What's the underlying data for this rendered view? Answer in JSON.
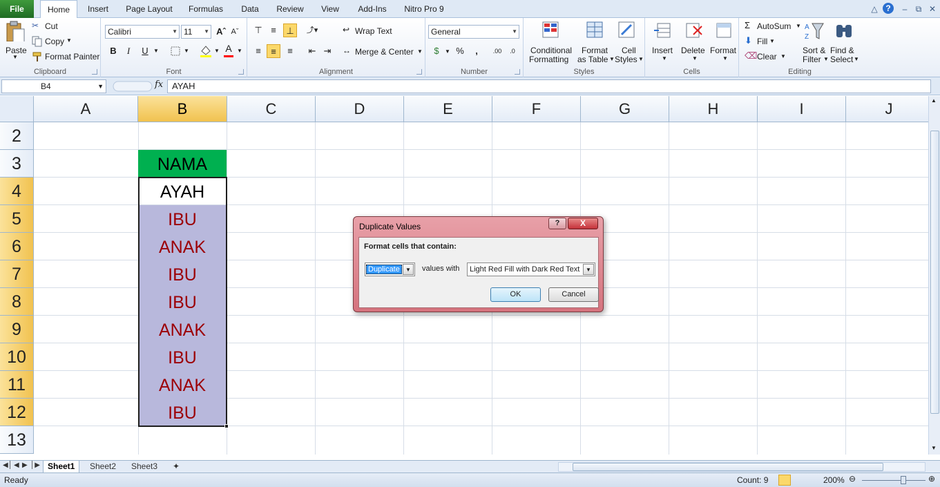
{
  "tabs": {
    "file": "File",
    "items": [
      "Home",
      "Insert",
      "Page Layout",
      "Formulas",
      "Data",
      "Review",
      "View",
      "Add-Ins",
      "Nitro Pro 9"
    ]
  },
  "clipboard": {
    "paste": "Paste",
    "cut": "Cut",
    "copy": "Copy",
    "format_painter": "Format Painter",
    "label": "Clipboard"
  },
  "font": {
    "name": "Calibri",
    "size": "11",
    "bold": "B",
    "italic": "I",
    "underline": "U",
    "label": "Font"
  },
  "alignment": {
    "wrap_text": "Wrap Text",
    "merge_center": "Merge & Center",
    "label": "Alignment"
  },
  "number": {
    "format": "General",
    "label": "Number"
  },
  "styles": {
    "conditional": [
      "Conditional",
      "Formatting"
    ],
    "format_table": [
      "Format",
      "as Table"
    ],
    "cell_styles": [
      "Cell",
      "Styles"
    ],
    "label": "Styles"
  },
  "cells": {
    "insert": "Insert",
    "delete": "Delete",
    "format": "Format",
    "label": "Cells"
  },
  "editing": {
    "autosum": "AutoSum",
    "fill": "Fill",
    "clear": "Clear",
    "sort_filter": [
      "Sort &",
      "Filter"
    ],
    "find_select": [
      "Find &",
      "Select"
    ],
    "label": "Editing"
  },
  "formula_bar": {
    "name_box": "B4",
    "fx": "fx",
    "value": "AYAH"
  },
  "grid": {
    "columns": [
      "A",
      "B",
      "C",
      "D",
      "E",
      "F",
      "G",
      "H",
      "I",
      "J"
    ],
    "rows": [
      "2",
      "3",
      "4",
      "5",
      "6",
      "7",
      "8",
      "9",
      "10",
      "11",
      "12",
      "13"
    ],
    "cells": {
      "b3": "NAMA",
      "b4": "AYAH",
      "b5": "IBU",
      "b6": "ANAK",
      "b7": "IBU",
      "b8": "IBU",
      "b9": "ANAK",
      "b10": "IBU",
      "b11": "ANAK",
      "b12": "IBU"
    }
  },
  "sheets": [
    "Sheet1",
    "Sheet2",
    "Sheet3"
  ],
  "status": {
    "ready": "Ready",
    "count": "Count: 9",
    "zoom": "200%"
  },
  "dialog": {
    "title": "Duplicate Values",
    "help": "?",
    "close": "X",
    "heading": "Format cells that contain:",
    "condition": "Duplicate",
    "values_with": "values with",
    "format": "Light Red Fill with Dark Red Text",
    "ok": "OK",
    "cancel": "Cancel"
  },
  "colors": {
    "header_fill": "#00b050",
    "duplicate_fill": "#b8b8dc",
    "duplicate_text": "#9c0006",
    "selected_header": "#f1c24f"
  }
}
